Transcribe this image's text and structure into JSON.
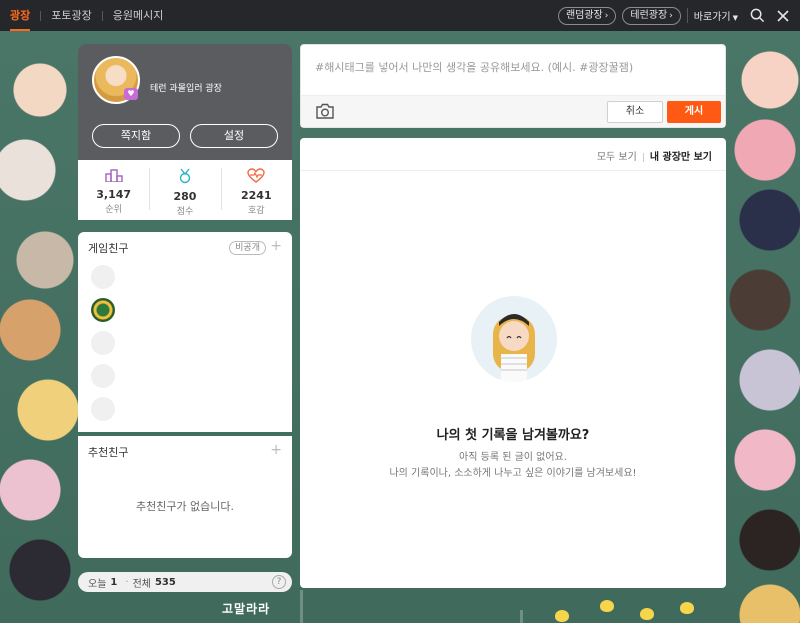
{
  "nav": {
    "tabs": [
      {
        "label": "광장"
      },
      {
        "label": "포토광장"
      },
      {
        "label": "응원메시지"
      }
    ],
    "pills": [
      {
        "label": "랜덤광장"
      },
      {
        "label": "테런광장"
      }
    ],
    "goto_label": "바로가기"
  },
  "profile": {
    "name": "테런 과몰입러 광장",
    "message_button": "쪽지함",
    "settings_button": "설정",
    "stats": [
      {
        "value": "3,147",
        "label": "순위"
      },
      {
        "value": "280",
        "label": "점수"
      },
      {
        "value": "2241",
        "label": "호감"
      }
    ]
  },
  "friends": {
    "title": "게임친구",
    "private_tag": "비공개",
    "plus": "+"
  },
  "recommend": {
    "title": "추천친구",
    "plus": "+",
    "empty": "추천친구가 없습니다."
  },
  "counter": {
    "today_label": "오늘",
    "today_value": "1",
    "dot": "·",
    "total_label": "전체",
    "total_value": "535",
    "help": "?"
  },
  "compose": {
    "placeholder": "#해시태그를 넣어서 나만의 생각을 공유해보세요. (예시. #광장꿀잼)",
    "cancel": "취소",
    "post": "게시"
  },
  "feed": {
    "filter_all": "모두 보기",
    "filter_mine": "내 광장만 보기",
    "empty_title": "나의 첫 기록을 남겨볼까요?",
    "empty_line1": "아직 등록 된 글이 없어요.",
    "empty_line2": "나의 기록이나, 소소하게 나누고 싶은 이야기를 남겨보세요!"
  },
  "footer_logo": "고말라라",
  "colors": {
    "accent": "#ff5a14",
    "topbar": "#26272b",
    "profile_bg": "#5b5c60"
  }
}
